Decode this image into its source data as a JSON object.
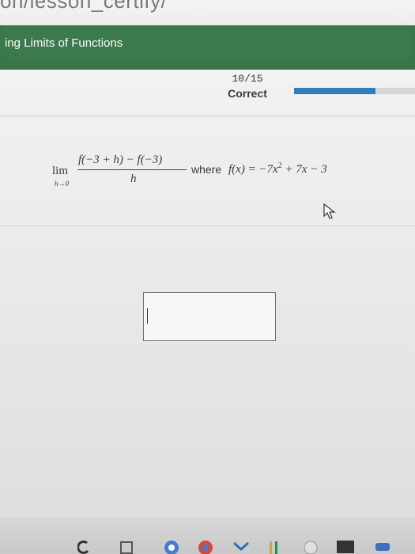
{
  "browser": {
    "url_fragment": "on/lesson_certify/"
  },
  "header": {
    "title": "ing Limits of Functions"
  },
  "progress": {
    "count": "10/15",
    "status": "Correct",
    "fraction": 0.67,
    "color": "#2c7fc0"
  },
  "problem": {
    "lim_word": "lim",
    "lim_subscript": "h→0",
    "numerator": "f(−3 + h) − f(−3)",
    "denominator": "h",
    "where_word": "where",
    "function_lhs": "f(x) = −7x",
    "function_exponent": "2",
    "function_rhs": " + 7x − 3"
  },
  "answer": {
    "value": ""
  },
  "taskbar": {
    "icons": [
      "refresh-icon",
      "files-icon",
      "chrome-icon",
      "chrome-icon",
      "mail-icon",
      "maps-icon",
      "music-icon",
      "calculator-icon",
      "zoom-icon"
    ]
  },
  "colors": {
    "header_green": "#3b7a4c",
    "progress_blue": "#2c7fc0"
  }
}
